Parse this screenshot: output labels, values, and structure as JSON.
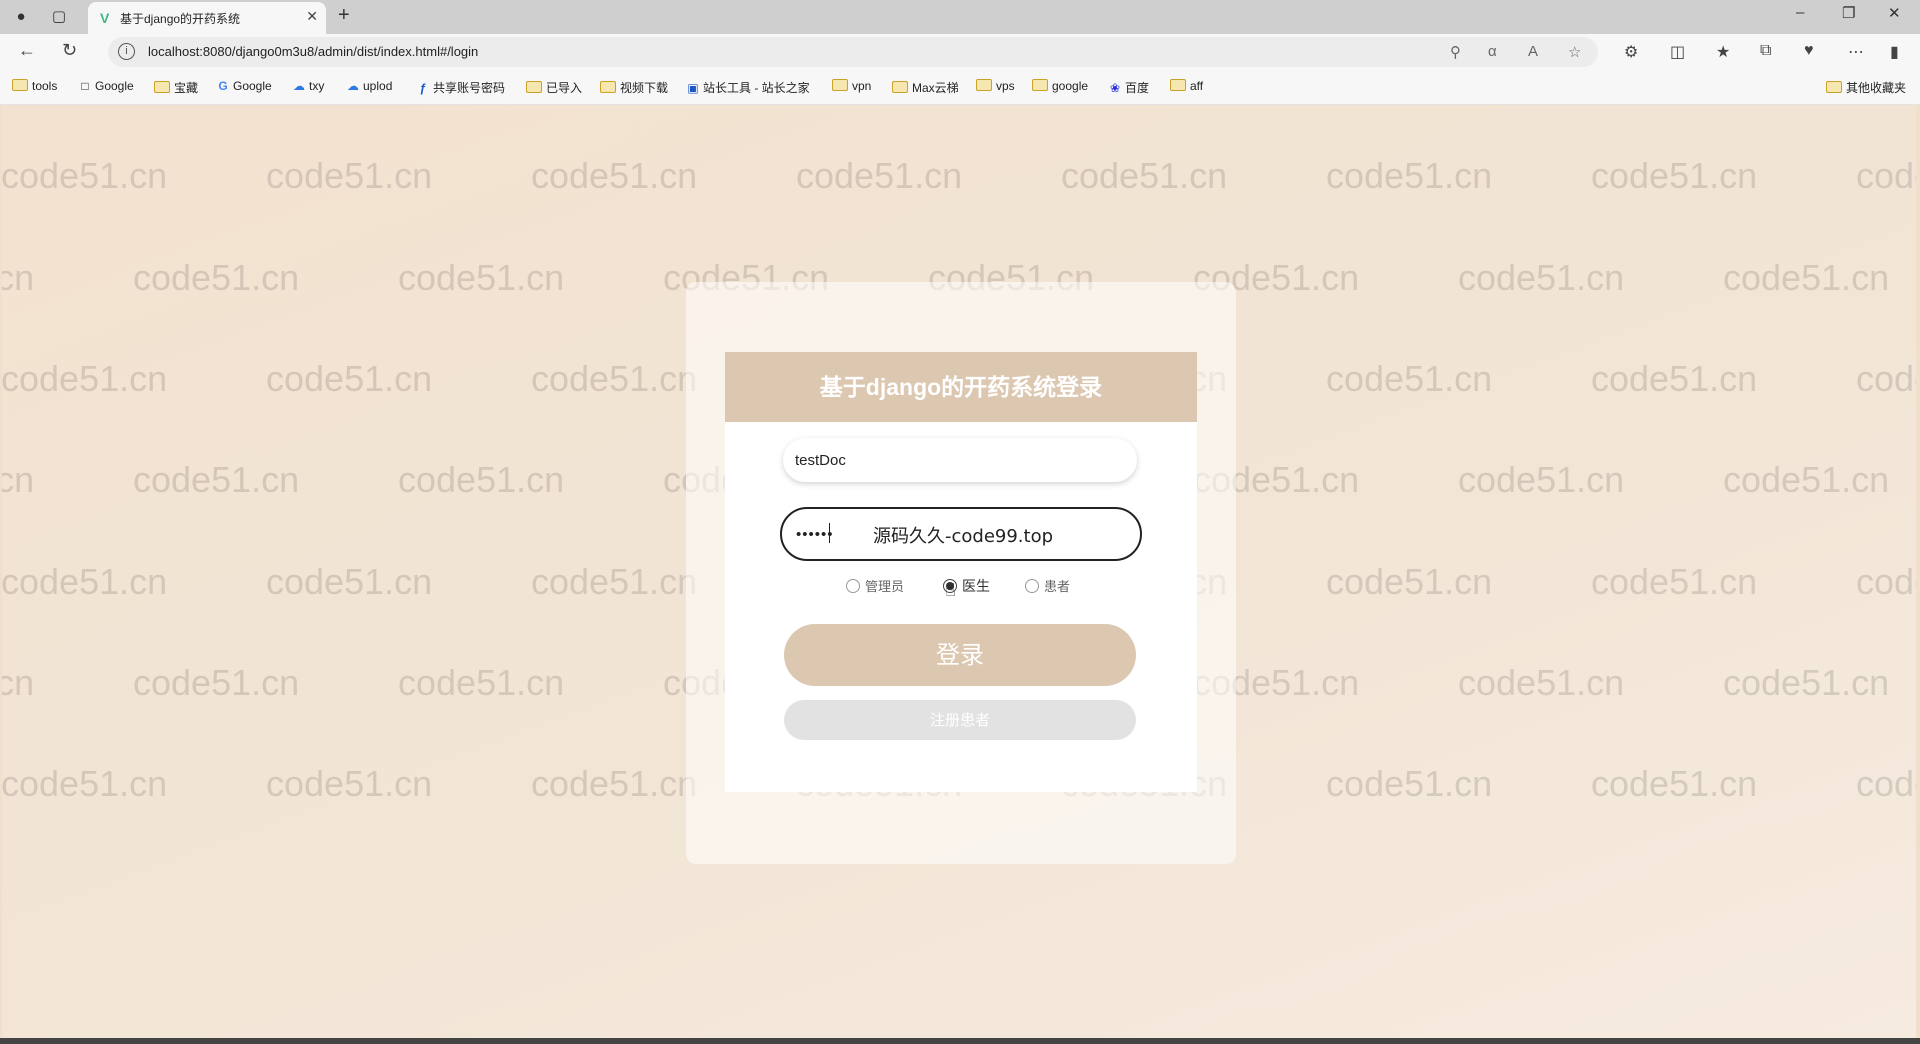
{
  "browser": {
    "tab_title": "基于django的开药系统",
    "url": "localhost:8080/django0m3u8/admin/dist/index.html#/login",
    "bookmarks": [
      {
        "label": "tools",
        "icon": "folder-icon"
      },
      {
        "label": "Google",
        "icon": "page-icon"
      },
      {
        "label": "宝藏",
        "icon": "folder-icon"
      },
      {
        "label": "Google",
        "icon": "google-icon"
      },
      {
        "label": "txy",
        "icon": "cloud-icon"
      },
      {
        "label": "uplod",
        "icon": "cloud-icon"
      },
      {
        "label": "共享账号密码",
        "icon": "link-icon"
      },
      {
        "label": "已导入",
        "icon": "folder-icon"
      },
      {
        "label": "视频下载",
        "icon": "folder-icon"
      },
      {
        "label": "站长工具 - 站长之家",
        "icon": "site-icon"
      },
      {
        "label": "vpn",
        "icon": "folder-icon"
      },
      {
        "label": "Max云梯",
        "icon": "folder-icon"
      },
      {
        "label": "vps",
        "icon": "folder-icon"
      },
      {
        "label": "google",
        "icon": "folder-icon"
      },
      {
        "label": "百度",
        "icon": "baidu-icon"
      },
      {
        "label": "aff",
        "icon": "folder-icon"
      }
    ],
    "other_bookmarks": "其他收藏夹"
  },
  "watermark": "code51.cn",
  "login": {
    "title": "基于django的开药系统登录",
    "username_value": "testDoc",
    "password_value": "••••••",
    "overlay_text": "源码久久-code99.top",
    "roles": [
      {
        "label": "管理员",
        "checked": false
      },
      {
        "label": "医生",
        "checked": true
      },
      {
        "label": "患者",
        "checked": false
      }
    ],
    "login_button": "登录",
    "register_button": "注册患者"
  },
  "colors": {
    "accent": "#dcc7b0",
    "page_background": "#f2e3d2"
  }
}
